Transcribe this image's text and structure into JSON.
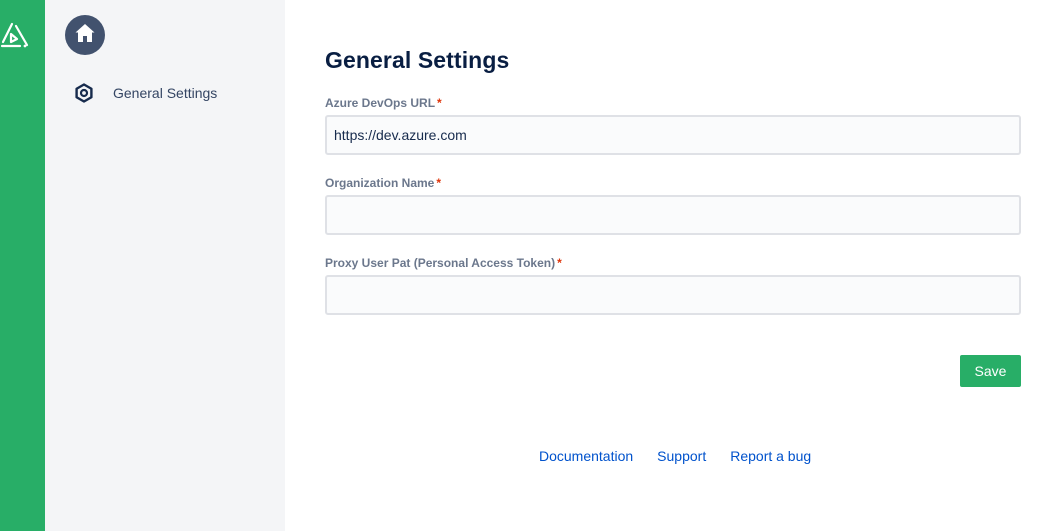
{
  "app": {
    "logo_icon": "triangle-logo-icon",
    "brand_color": "#28ae67"
  },
  "sidebar": {
    "home_icon": "home-icon",
    "items": [
      {
        "label": "General Settings",
        "icon": "hexagon-gear-icon"
      }
    ]
  },
  "main": {
    "title": "General Settings",
    "fields": [
      {
        "label": "Azure DevOps URL",
        "required_mark": "*",
        "value": "https://dev.azure.com",
        "placeholder": ""
      },
      {
        "label": "Organization Name",
        "required_mark": "*",
        "value": "",
        "placeholder": ""
      },
      {
        "label": "Proxy User Pat (Personal Access Token)",
        "required_mark": "*",
        "value": "",
        "placeholder": ""
      }
    ],
    "save_label": "Save"
  },
  "footer": {
    "links": [
      "Documentation",
      "Support",
      "Report a bug"
    ]
  }
}
